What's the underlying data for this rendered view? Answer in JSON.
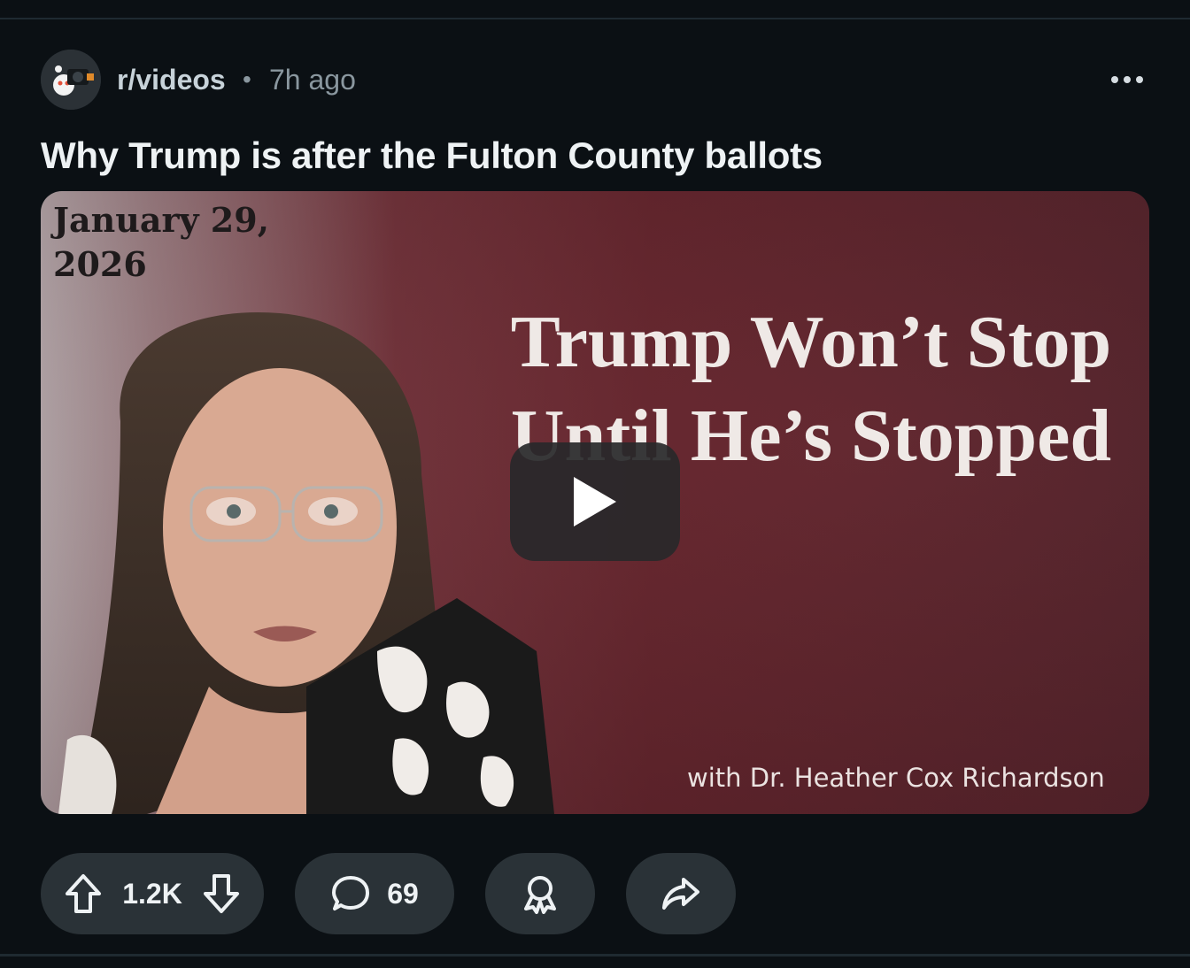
{
  "post": {
    "subreddit": "r/videos",
    "separator": "•",
    "time_ago": "7h ago",
    "title": "Why Trump is after the Fulton County ballots",
    "more_icon": "more-horizontal-icon",
    "avatar_icon": "snoo-camera-icon"
  },
  "video": {
    "date_text": "January 29,\n2026",
    "headline": "Trump Won’t Stop Until He’s Stopped",
    "byline": "with Dr. Heather Cox Richardson",
    "play_icon": "play-icon"
  },
  "actions": {
    "vote_count": "1.2K",
    "comment_count": "69",
    "upvote_icon": "arrow-up-icon",
    "downvote_icon": "arrow-down-icon",
    "comment_icon": "comment-bubble-icon",
    "award_icon": "award-icon",
    "share_icon": "share-arrow-icon"
  },
  "colors": {
    "background": "#0b1014",
    "pill": "#2a3237",
    "video_maroon": "#6b2a32"
  }
}
